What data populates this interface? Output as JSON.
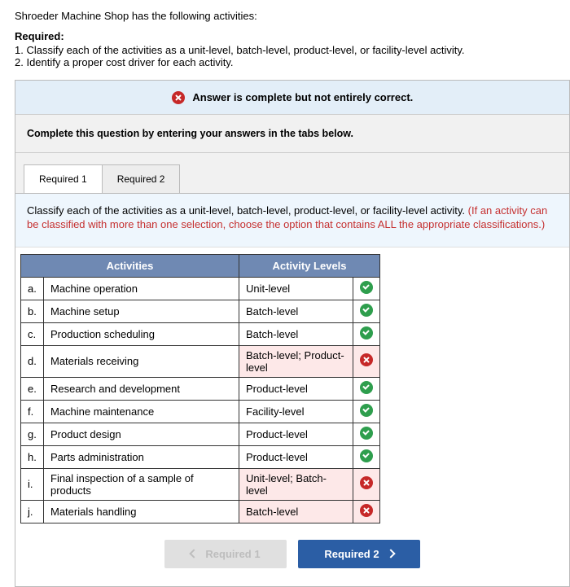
{
  "intro": "Shroeder Machine Shop has the following activities:",
  "required_label": "Required:",
  "required_lines": [
    "1. Classify each of the activities as a unit-level, batch-level, product-level, or facility-level activity.",
    "2. Identify a proper cost driver for each activity."
  ],
  "status_text": "Answer is complete but not entirely correct.",
  "complete_msg": "Complete this question by entering your answers in the tabs below.",
  "tabs": {
    "r1": "Required 1",
    "r2": "Required 2"
  },
  "hint_black": "Classify each of the activities as a unit-level, batch-level, product-level, or facility-level activity. ",
  "hint_red": "(If an activity can be classified with more than one selection, choose the option that contains ALL the appropriate classifications.)",
  "table": {
    "head_activities": "Activities",
    "head_levels": "Activity Levels",
    "rows": [
      {
        "letter": "a.",
        "activity": "Machine operation",
        "level": "Unit-level",
        "correct": true
      },
      {
        "letter": "b.",
        "activity": "Machine setup",
        "level": "Batch-level",
        "correct": true
      },
      {
        "letter": "c.",
        "activity": "Production scheduling",
        "level": "Batch-level",
        "correct": true
      },
      {
        "letter": "d.",
        "activity": "Materials receiving",
        "level": "Batch-level; Product-level",
        "correct": false
      },
      {
        "letter": "e.",
        "activity": "Research and development",
        "level": "Product-level",
        "correct": true
      },
      {
        "letter": "f.",
        "activity": "Machine maintenance",
        "level": "Facility-level",
        "correct": true
      },
      {
        "letter": "g.",
        "activity": "Product design",
        "level": "Product-level",
        "correct": true
      },
      {
        "letter": "h.",
        "activity": "Parts administration",
        "level": "Product-level",
        "correct": true
      },
      {
        "letter": "i.",
        "activity": "Final inspection of a sample of products",
        "level": "Unit-level; Batch-level",
        "correct": false
      },
      {
        "letter": "j.",
        "activity": "Materials handling",
        "level": "Batch-level",
        "correct": false
      }
    ]
  },
  "nav": {
    "prev": "Required 1",
    "next": "Required 2"
  }
}
